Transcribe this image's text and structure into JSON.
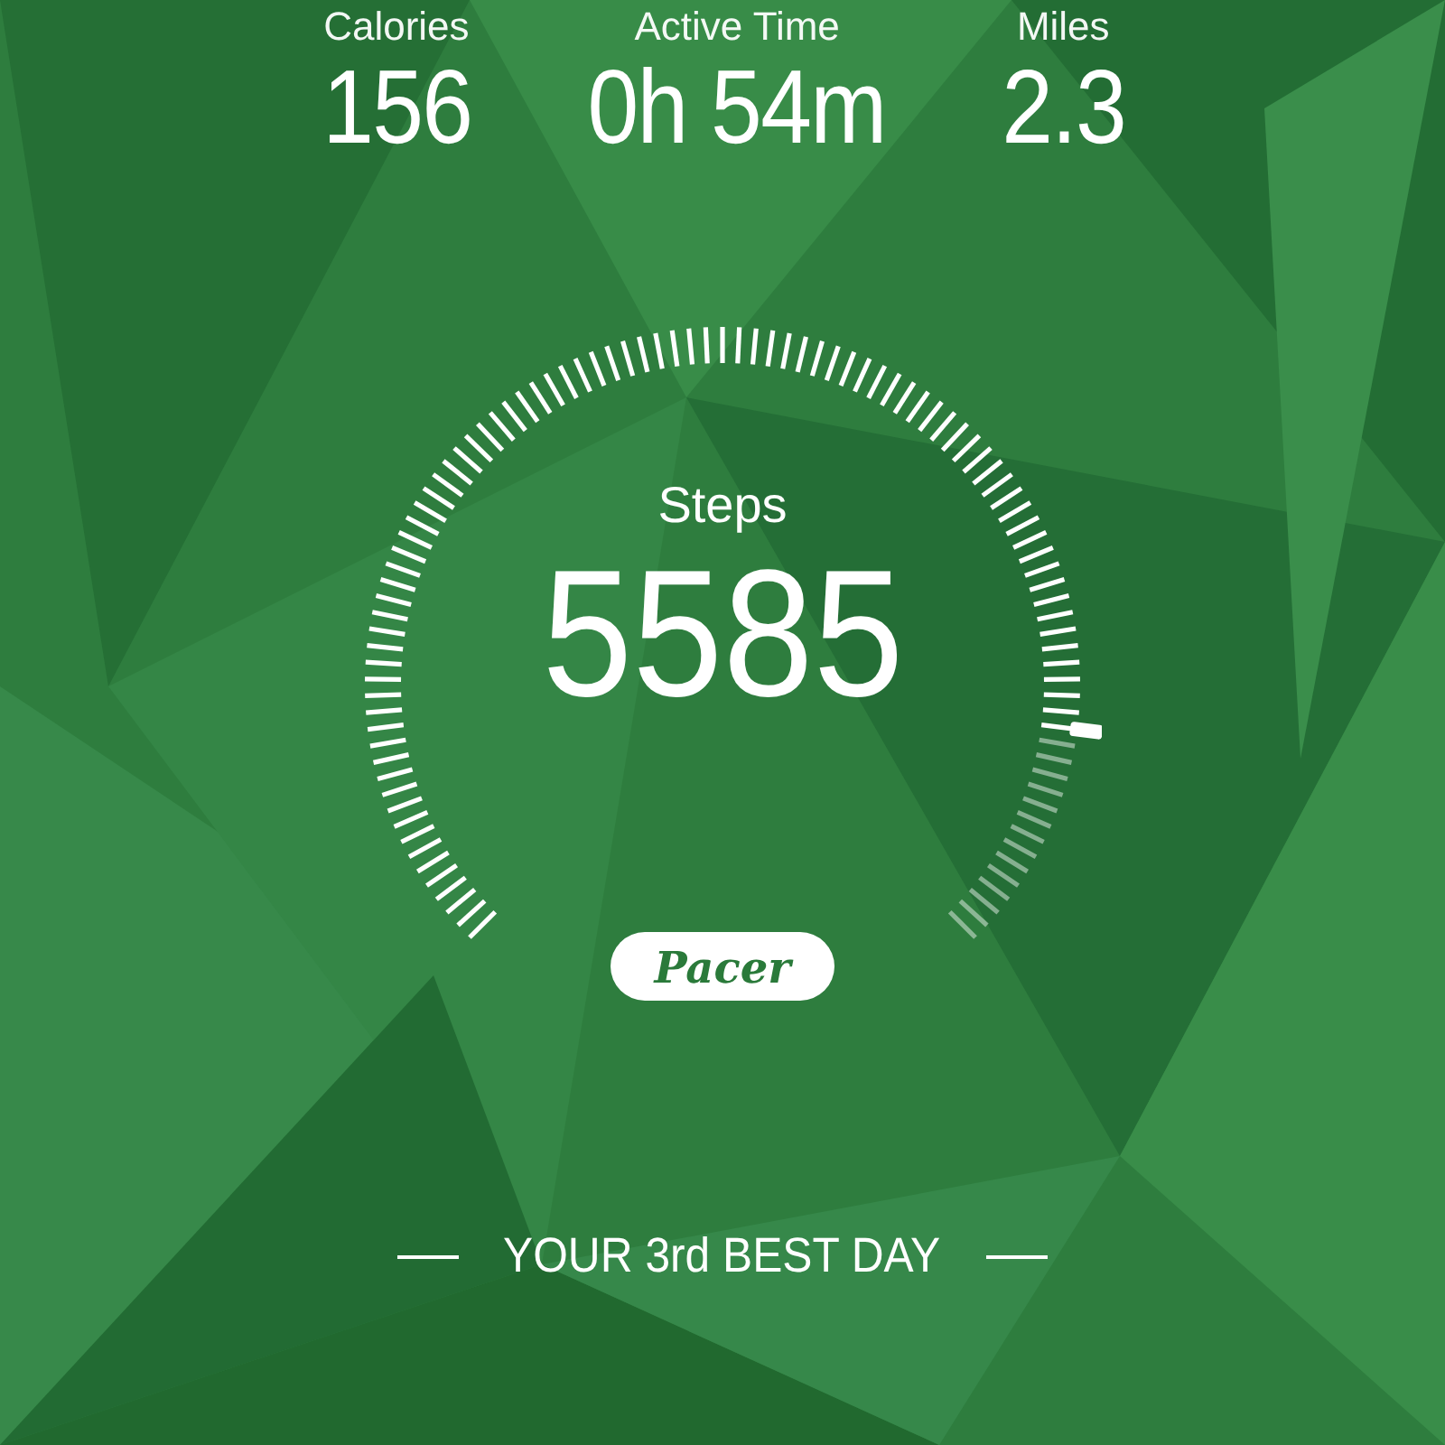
{
  "stats": [
    {
      "label": "Calories",
      "value": "156"
    },
    {
      "label": "Active Time",
      "value": "0h 54m"
    },
    {
      "label": "Miles",
      "value": "2.3"
    }
  ],
  "steps": {
    "label": "Steps",
    "value": "5585"
  },
  "badge": "Pacer",
  "footer": "YOUR 3rd BEST DAY"
}
